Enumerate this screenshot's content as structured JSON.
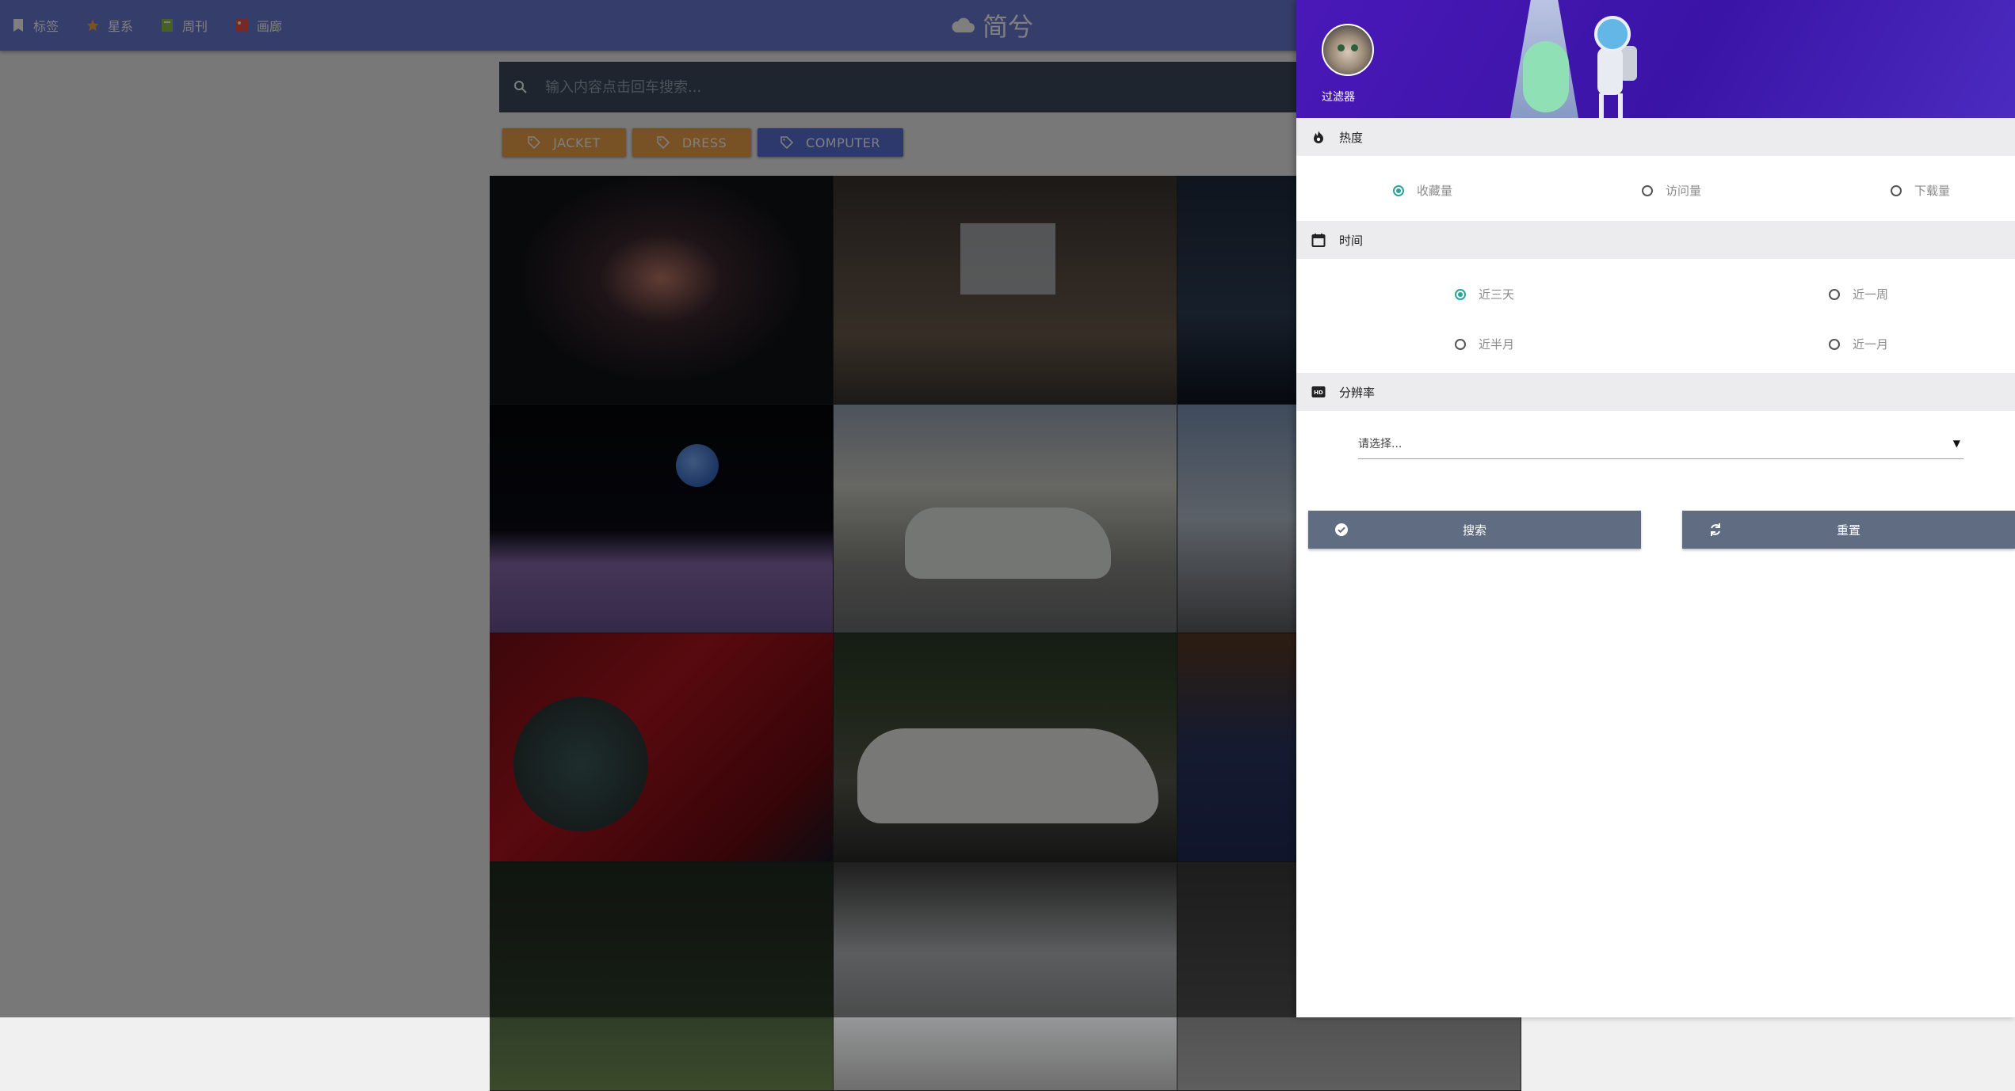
{
  "nav": {
    "items": [
      {
        "label": "标签",
        "icon": "bookmark-icon",
        "color": "#ffffff"
      },
      {
        "label": "星系",
        "icon": "star-icon",
        "color": "#f1a24a"
      },
      {
        "label": "周刊",
        "icon": "book-icon",
        "color": "#8bc34a"
      },
      {
        "label": "画廊",
        "icon": "gallery-icon",
        "color": "#ef5350"
      }
    ],
    "brand": "简兮",
    "brand_icon": "cloud-icon"
  },
  "search": {
    "placeholder": "输入内容点击回车搜索...",
    "icon": "search-icon"
  },
  "tags": [
    {
      "label": "JACKET",
      "color": "#f1a24a"
    },
    {
      "label": "DRESS",
      "color": "#f1a24a"
    },
    {
      "label": "COMPUTER",
      "color": "#5b73d9"
    }
  ],
  "drawer": {
    "title": "过滤器",
    "popularity": {
      "heading": "热度",
      "icon": "flame-icon",
      "options": [
        "收藏量",
        "访问量",
        "下载量"
      ],
      "selected": "收藏量"
    },
    "time": {
      "heading": "时间",
      "icon": "calendar-icon",
      "options": [
        "近三天",
        "近一周",
        "近半月",
        "近一月"
      ],
      "selected": "近三天"
    },
    "resolution": {
      "heading": "分辨率",
      "icon": "hd-icon",
      "placeholder": "请选择..."
    },
    "buttons": {
      "search": "搜索",
      "reset": "重置"
    },
    "accent": "#26a69a"
  },
  "colors": {
    "topbar": "#6b7bd6",
    "search_bar": "#3d4b5f",
    "button": "#5f6c82",
    "drawer_header": "#4a18b8"
  }
}
